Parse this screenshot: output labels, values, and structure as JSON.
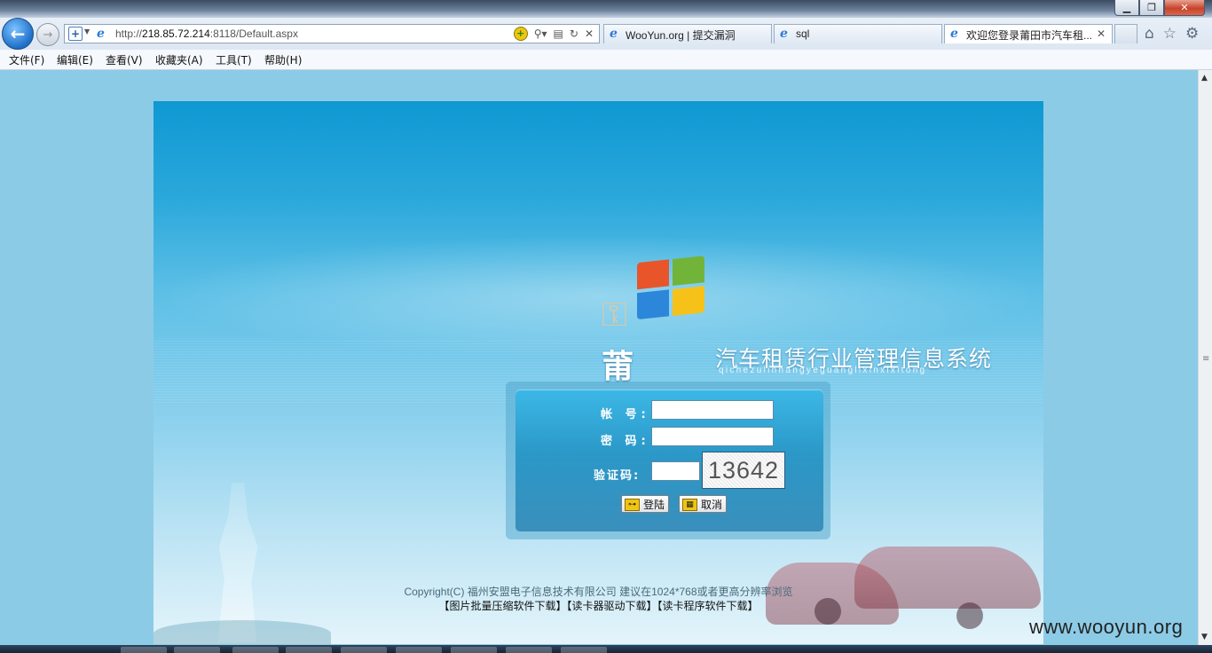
{
  "window": {
    "minimize": "▁",
    "maximize": "❐",
    "close": "✕"
  },
  "nav": {
    "back": "←",
    "forward": "→"
  },
  "address": {
    "url_prefix": "http://",
    "url_host": "218.85.72.214",
    "url_rest": ":8118/Default.aspx"
  },
  "tabs": [
    {
      "title": "WooYun.org | 提交漏洞"
    },
    {
      "title": "sql"
    },
    {
      "title": "欢迎您登录莆田市汽车租..."
    }
  ],
  "menu": [
    "文件(F)",
    "编辑(E)",
    "查看(V)",
    "收藏夹(A)",
    "工具(T)",
    "帮助(H)"
  ],
  "brand": {
    "city": "莆田市",
    "system": "汽车租赁行业管理信息系统",
    "pinyin": "qichezulinhangyeguanglixinxixitong"
  },
  "login": {
    "account_label": "帐 号:",
    "password_label": "密 码:",
    "captcha_label": "验证码:",
    "account_value": "",
    "password_value": "",
    "captcha_value": "",
    "captcha_image_text": "13642",
    "login_button": "登陆",
    "cancel_button": "取消"
  },
  "footer": {
    "copyright": "Copyright(C) 福州安盟电子信息技术有限公司  建议在1024*768或者更高分辨率浏览",
    "links": [
      "【图片批量压缩软件下载】",
      "【读卡器驱动下载】",
      "【读卡程序软件下载】"
    ]
  },
  "watermark": "www.wooyun.org",
  "colors": {
    "panel_top": "#0f98d3",
    "login_box": "#2b98c8",
    "page_bg": "#8ccbe6"
  }
}
